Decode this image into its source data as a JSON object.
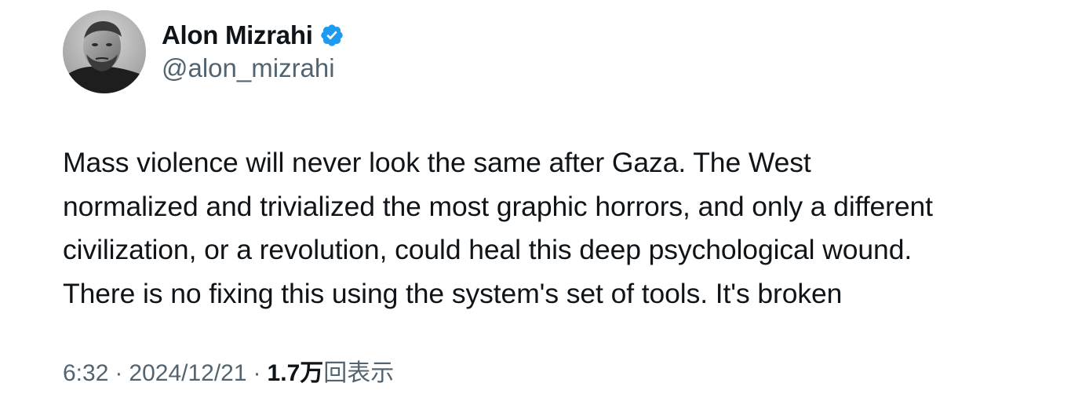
{
  "author": {
    "display_name": "Alon Mizrahi",
    "handle": "@alon_mizrahi",
    "verified": true,
    "verified_color": "#1d9bf0"
  },
  "tweet": {
    "text": "Mass violence will never look the same after Gaza. The West\nnormalized and trivialized the most graphic horrors, and only a different\ncivilization, or a revolution, could heal this deep psychological wound.\nThere is no fixing this using the system's set of tools. It's broken"
  },
  "meta": {
    "time": "6:32",
    "separator": "·",
    "date": "2024/12/21",
    "views_count": "1.7万",
    "views_label": "回表示"
  },
  "icons": {
    "avatar": "profile-photo",
    "verified": "verified-badge-icon"
  }
}
